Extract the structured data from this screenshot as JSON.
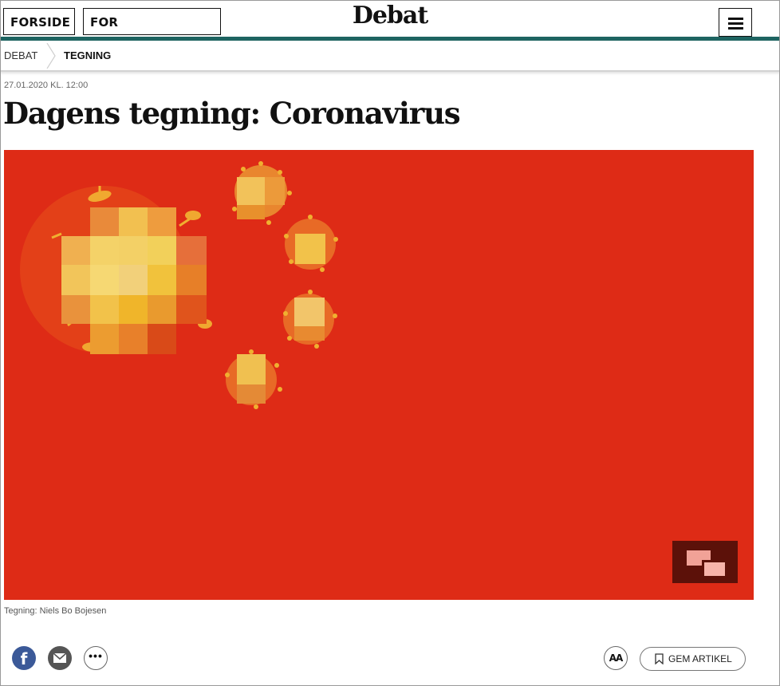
{
  "header": {
    "forside_label": "FORSIDE",
    "abonnenter_label": "FOR ABONNENTER",
    "logo": "Debat",
    "accent_color": "#1e6461"
  },
  "breadcrumb": {
    "section": "DEBAT",
    "current": "TEGNING"
  },
  "article": {
    "date": "27.01.2020 KL. 12:00",
    "title": "Dagens tegning: Coronavirus",
    "image": {
      "background_color": "#de2b16",
      "description_icon": "china-flag-virus-illustration"
    },
    "caption": "Tegning: Niels Bo Bojesen"
  },
  "share": {
    "facebook_glyph": "f",
    "more_glyph": "•••",
    "font_size_label": "AA",
    "save_label": "GEM ARTIKEL"
  }
}
